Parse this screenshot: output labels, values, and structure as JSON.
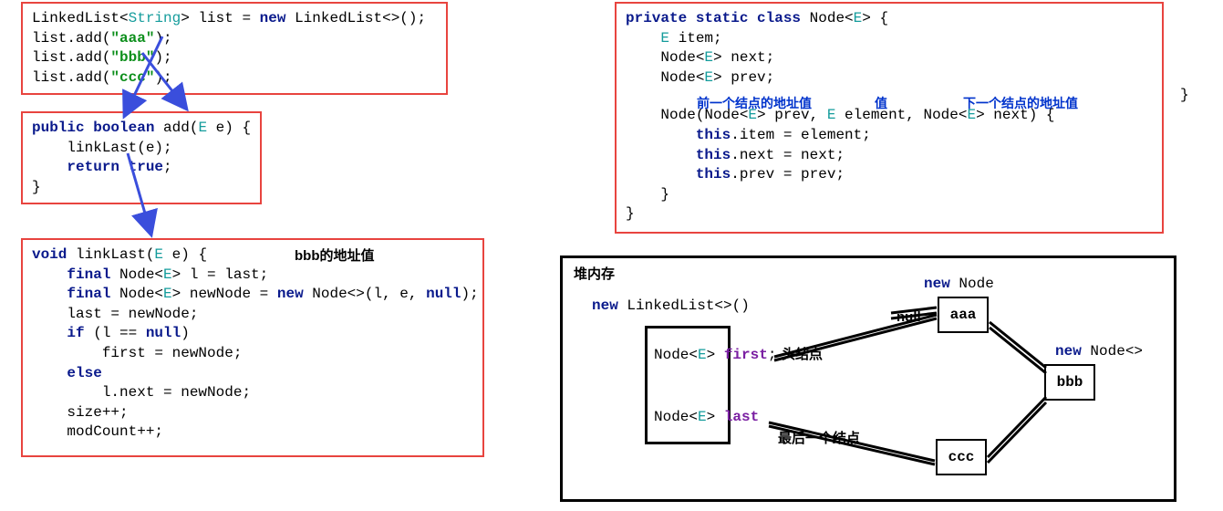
{
  "box1": {
    "l1_a": "LinkedList<",
    "l1_tp": "String",
    "l1_b": "> list = ",
    "l1_kw": "new",
    "l1_c": " LinkedList<>();",
    "l2_a": "list.add(",
    "l2_s": "\"aaa\"",
    "l2_b": ");",
    "l3_a": "list.add(",
    "l3_s": "\"bbb\"",
    "l3_b": ");",
    "l4_a": "list.add(",
    "l4_s": "\"ccc\"",
    "l4_b": ");"
  },
  "box2": {
    "l1_kw1": "public boolean",
    "l1_b": " add(",
    "l1_tp": "E",
    "l1_c": " e) {",
    "l2": "    linkLast(e);",
    "l3_a": "    ",
    "l3_kw": "return true",
    "l3_b": ";",
    "l4": "}"
  },
  "box3": {
    "ann": "bbb的地址值",
    "l1_kw": "void",
    "l1_b": " linkLast(",
    "l1_tp": "E",
    "l1_c": " e) {",
    "l2_a": "    ",
    "l2_kw": "final",
    "l2_b": " Node<",
    "l2_tp": "E",
    "l2_c": "> l = last;",
    "l3_a": "    ",
    "l3_kw1": "final",
    "l3_b": " Node<",
    "l3_tp": "E",
    "l3_c": "> newNode = ",
    "l3_kw2": "new",
    "l3_d": " Node<>(l, e, ",
    "l3_kw3": "null",
    "l3_e": ");",
    "l4": "    last = newNode;",
    "l5_a": "    ",
    "l5_kw": "if",
    "l5_b": " (l == ",
    "l5_kw2": "null",
    "l5_c": ")",
    "l6": "        first = newNode;",
    "l7_a": "    ",
    "l7_kw": "else",
    "l8": "        l.next = newNode;",
    "l9": "    size++;",
    "l10": "    modCount++;"
  },
  "box4": {
    "l1_kw": "private static class",
    "l1_b": " Node<",
    "l1_tp": "E",
    "l1_c": "> {",
    "l2_a": "    ",
    "l2_tp": "E",
    "l2_b": " item;",
    "l3_a": "    Node<",
    "l3_tp": "E",
    "l3_b": "> next;",
    "l4_a": "    Node<",
    "l4_tp": "E",
    "l4_b": "> prev;",
    "ann_prev": "前一个结点的地址值",
    "ann_val": "值",
    "ann_next": "下一个结点的地址值",
    "l5_a": "    Node(Node<",
    "l5_tp1": "E",
    "l5_b": "> prev, ",
    "l5_tp2": "E",
    "l5_c": " element, Node<",
    "l5_tp3": "E",
    "l5_d": "> next) {",
    "l6_a": "        ",
    "l6_kw": "this",
    "l6_b": ".item = element;",
    "l7_a": "        ",
    "l7_kw": "this",
    "l7_b": ".next = next;",
    "l8_a": "        ",
    "l8_kw": "this",
    "l8_b": ".prev = prev;",
    "l9": "    }",
    "l10": "}",
    "rbrace": "}"
  },
  "heap": {
    "title": "堆内存",
    "newlist_kw": "new",
    "newlist_b": " LinkedList<>()",
    "first_a": "Node<",
    "first_tp": "E",
    "first_b": "> ",
    "first_nm": "first",
    "first_c": ";",
    "last_a": "Node<",
    "last_tp": "E",
    "last_b": "> ",
    "last_nm": "last",
    "head_label": "头结点",
    "tail_label": "最后一个结点",
    "null_label": "null",
    "newnode1_kw": "new",
    "newnode1_b": " Node",
    "newnode2_kw": "new",
    "newnode2_b": " Node<>",
    "aaa": "aaa",
    "bbb": "bbb",
    "ccc": "ccc"
  }
}
